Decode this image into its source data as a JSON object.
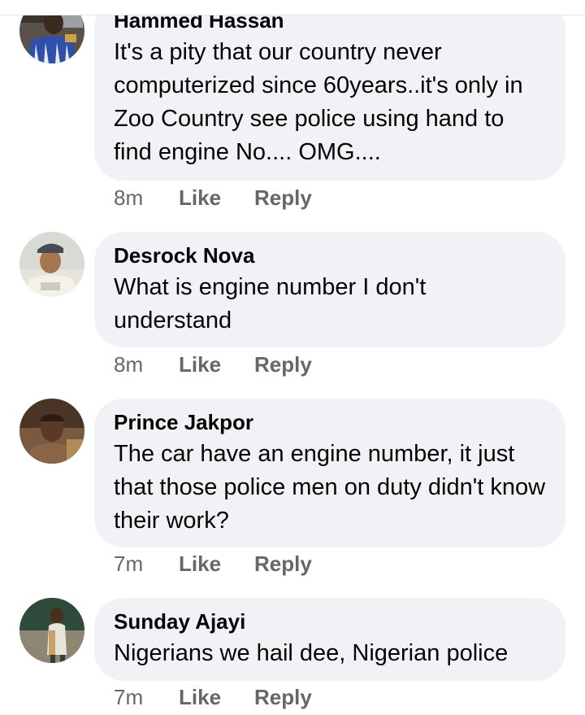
{
  "comments": [
    {
      "author": "Hammed Hassan",
      "text": "It's a pity that our country never computerized since 60years..it's only in Zoo Country see police using hand to find engine No.... OMG....",
      "time": "8m",
      "like_label": "Like",
      "reply_label": "Reply"
    },
    {
      "author": "Desrock Nova",
      "text": "What is engine number I don't understand",
      "time": "8m",
      "like_label": "Like",
      "reply_label": "Reply"
    },
    {
      "author": "Prince Jakpor",
      "text": "The car have an engine number, it just that those police men on duty didn't know their work?",
      "time": "7m",
      "like_label": "Like",
      "reply_label": "Reply"
    },
    {
      "author": "Sunday Ajayi",
      "text": "Nigerians we hail dee, Nigerian police",
      "time": "7m",
      "like_label": "Like",
      "reply_label": "Reply"
    }
  ],
  "colors": {
    "bubble_bg": "#f0f2f5",
    "meta_text": "#65676b",
    "body_text": "#050505"
  }
}
